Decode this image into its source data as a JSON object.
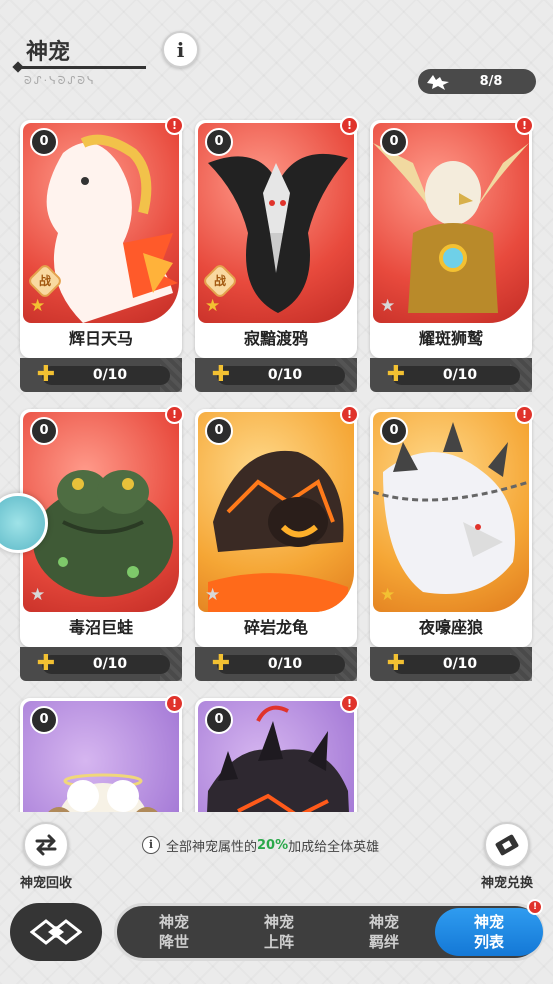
{
  "header": {
    "title": "神宠",
    "subtitle": "ᘐᔑ·ᓭᘐᔑᘐᓭ",
    "info_icon": "info-icon",
    "pet_count": "8/8"
  },
  "cards": [
    {
      "name": "辉日天马",
      "level": "0",
      "fragments": "0/10",
      "theme": "red",
      "star": "gold",
      "war_badge": "战",
      "art": "white-pegasus"
    },
    {
      "name": "寂黯渡鸦",
      "level": "0",
      "fragments": "0/10",
      "theme": "red",
      "star": "gold",
      "war_badge": "战",
      "art": "dark-raven"
    },
    {
      "name": "耀斑狮鹫",
      "level": "0",
      "fragments": "0/10",
      "theme": "red",
      "star": "grey",
      "war_badge": "",
      "art": "golden-griffin"
    },
    {
      "name": "毒沼巨蛙",
      "level": "0",
      "fragments": "0/10",
      "theme": "red",
      "star": "grey",
      "war_badge": "",
      "art": "swamp-toad"
    },
    {
      "name": "碎岩龙龟",
      "level": "0",
      "fragments": "0/10",
      "theme": "orange",
      "star": "grey",
      "war_badge": "",
      "art": "lava-turtle"
    },
    {
      "name": "夜嚎座狼",
      "level": "0",
      "fragments": "0/10",
      "theme": "orange",
      "star": "gold",
      "war_badge": "",
      "art": "white-wolf"
    },
    {
      "name": "",
      "level": "0",
      "fragments": "",
      "theme": "purple",
      "star": "",
      "war_badge": "",
      "art": "angel-sheep"
    },
    {
      "name": "",
      "level": "0",
      "fragments": "",
      "theme": "purple",
      "star": "",
      "war_badge": "",
      "art": "dark-lava-beast"
    }
  ],
  "bottom": {
    "recycle_label": "神宠回收",
    "exchange_label": "神宠兑换",
    "bonus_prefix": "全部神宠属性的",
    "bonus_percent": "20%",
    "bonus_suffix": "加成给全体英雄"
  },
  "tabs": [
    {
      "label": "神宠降世",
      "active": false
    },
    {
      "label": "神宠上阵",
      "active": false
    },
    {
      "label": "神宠羁绊",
      "active": false
    },
    {
      "label": "神宠列表",
      "active": true
    }
  ],
  "colors": {
    "accent_blue": "#1f8be6",
    "alert_red": "#e0332b",
    "bonus_green": "#2aa84a",
    "card_red": "#e84a3d",
    "card_orange": "#f5a635",
    "card_purple": "#a87ed8"
  }
}
